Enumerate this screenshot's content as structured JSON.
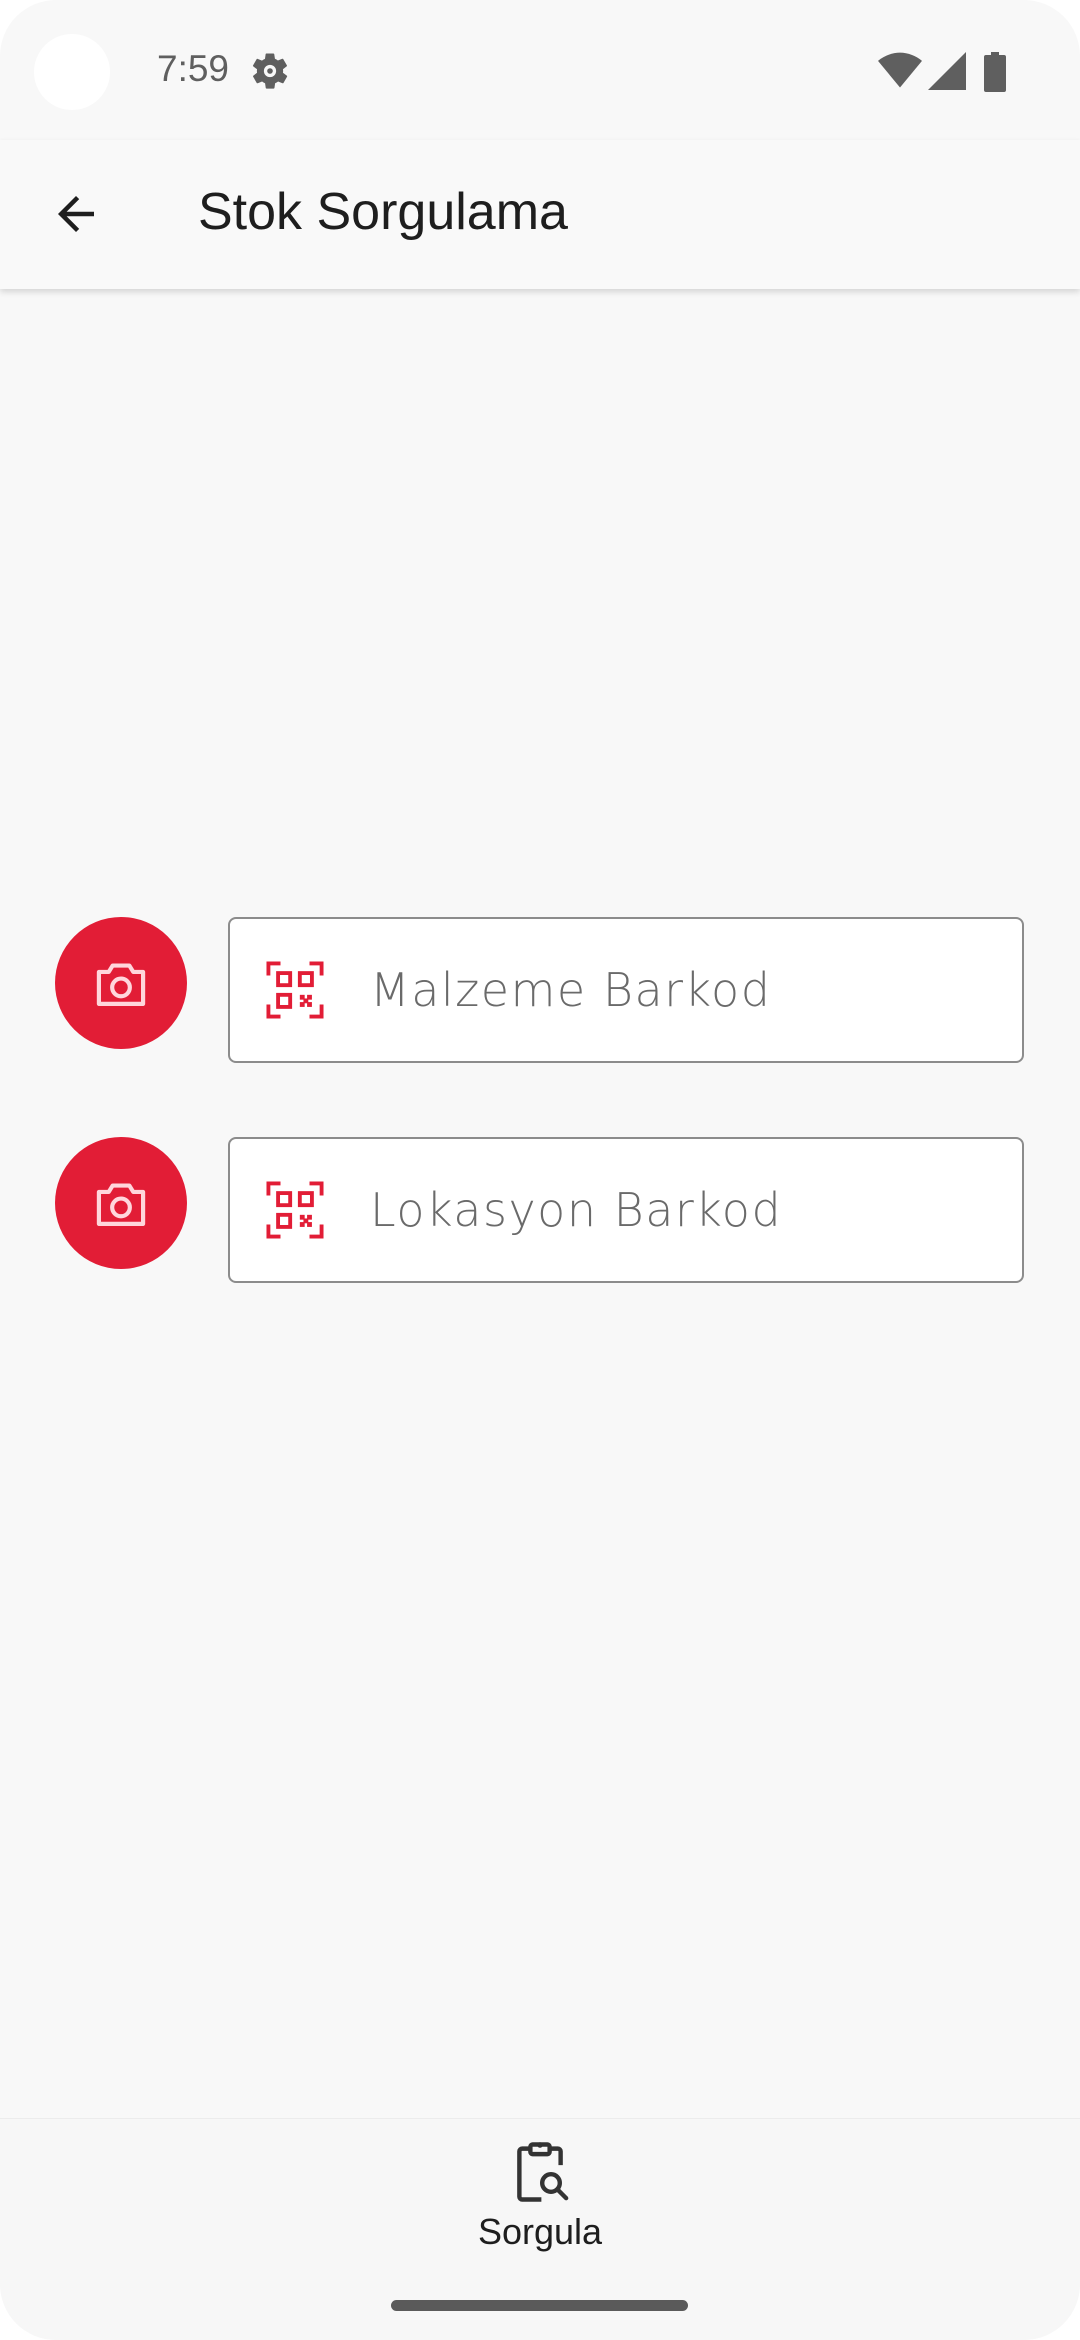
{
  "status_bar": {
    "time": "7:59",
    "icons": [
      "settings-gear-icon",
      "wifi-icon",
      "cellular-signal-icon",
      "battery-icon"
    ]
  },
  "app_bar": {
    "title": "Stok Sorgulama",
    "back_icon": "arrow-back-icon"
  },
  "form": {
    "fields": [
      {
        "placeholder": "Malzeme Barkod",
        "value": "",
        "leading_icon": "qr-code-scan-icon",
        "scan_button_icon": "camera-icon"
      },
      {
        "placeholder": "Lokasyon Barkod",
        "value": "",
        "leading_icon": "qr-code-scan-icon",
        "scan_button_icon": "camera-icon"
      }
    ]
  },
  "bottom_nav": {
    "items": [
      {
        "label": "Sorgula",
        "icon": "clipboard-search-icon"
      }
    ]
  },
  "colors": {
    "accent": "#e21d36",
    "background": "#f8f8f8",
    "app_bar": "#f9f9f9",
    "text_primary": "#1e1e1e",
    "field_border": "#8c8c8c"
  }
}
